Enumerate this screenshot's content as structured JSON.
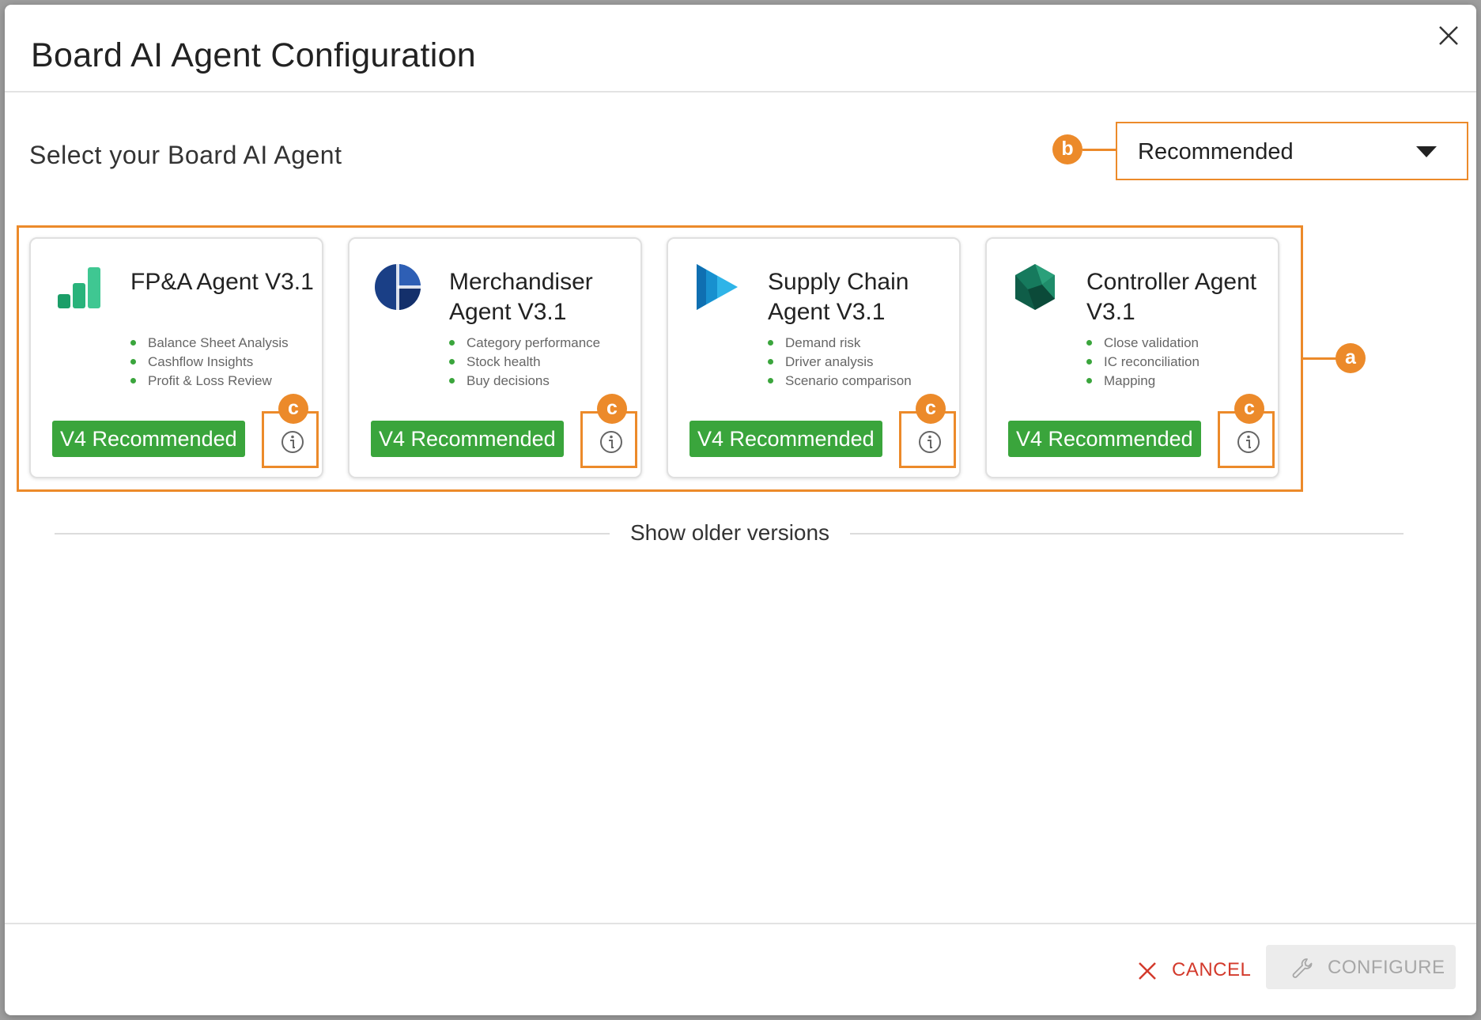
{
  "dialog": {
    "title": "Board AI Agent Configuration",
    "close_icon": "close-icon"
  },
  "selector": {
    "label": "Select your Board AI Agent",
    "dropdown_value": "Recommended"
  },
  "callouts": {
    "a": "a",
    "b": "b",
    "c": "c"
  },
  "cards": [
    {
      "title": "FP&A Agent V3.1",
      "features": [
        "Balance Sheet Analysis",
        "Cashflow Insights",
        "Profit & Loss Review"
      ],
      "badge": "V4 Recommended",
      "logo": "fpa-bars-logo"
    },
    {
      "title": "Merchandiser Agent V3.1",
      "features": [
        "Category performance",
        "Stock health",
        "Buy decisions"
      ],
      "badge": "V4 Recommended",
      "logo": "merchandiser-circle-logo"
    },
    {
      "title": "Supply Chain Agent V3.1",
      "features": [
        "Demand risk",
        "Driver analysis",
        "Scenario comparison"
      ],
      "badge": "V4 Recommended",
      "logo": "supply-chain-play-logo"
    },
    {
      "title": "Controller Agent V3.1",
      "features": [
        "Close validation",
        "IC reconciliation",
        "Mapping"
      ],
      "badge": "V4 Recommended",
      "logo": "controller-hexagon-logo"
    }
  ],
  "show_older": "Show older versions",
  "footer": {
    "cancel_label": "CANCEL",
    "configure_label": "CONFIGURE"
  },
  "colors": {
    "accent_orange": "#ec8a2a",
    "badge_green": "#3aa53c",
    "cancel_red": "#d33a2c"
  }
}
